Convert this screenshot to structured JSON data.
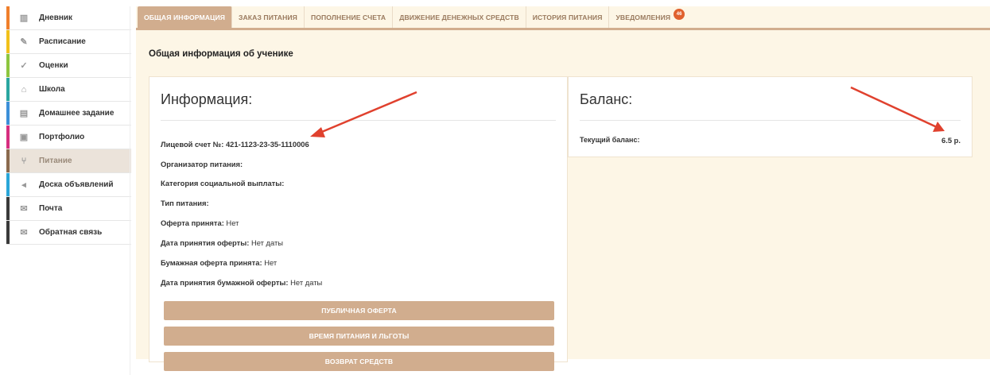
{
  "sidebar": {
    "items": [
      {
        "label": "Дневник",
        "icon": "book-icon",
        "color": "#f07f2b",
        "glyph": "▥"
      },
      {
        "label": "Расписание",
        "icon": "pin-icon",
        "color": "#f2c11b",
        "glyph": "✎"
      },
      {
        "label": "Оценки",
        "icon": "check-icon",
        "color": "#8dc63f",
        "glyph": "✓"
      },
      {
        "label": "Школа",
        "icon": "school-icon",
        "color": "#2aa6a0",
        "glyph": "⌂"
      },
      {
        "label": "Домашнее задание",
        "icon": "homework-icon",
        "color": "#3c8fd8",
        "glyph": "▤"
      },
      {
        "label": "Портфолио",
        "icon": "portfolio-icon",
        "color": "#d62e7f",
        "glyph": "▣"
      },
      {
        "label": "Питание",
        "icon": "food-icon",
        "color": "#8a6a4e",
        "glyph": "⑂"
      },
      {
        "label": "Доска объявлений",
        "icon": "megaphone-icon",
        "color": "#2aa6d8",
        "glyph": "◂"
      },
      {
        "label": "Почта",
        "icon": "mail-icon",
        "color": "#3a3a3a",
        "glyph": "✉"
      },
      {
        "label": "Обратная связь",
        "icon": "feedback-icon",
        "color": "#3a3a3a",
        "glyph": "✉"
      }
    ],
    "active_index": 6
  },
  "tabs": [
    {
      "label": "ОБЩАЯ ИНФОРМАЦИЯ",
      "active": true
    },
    {
      "label": "ЗАКАЗ ПИТАНИЯ",
      "active": false
    },
    {
      "label": "ПОПОЛНЕНИЕ СЧЕТА",
      "active": false
    },
    {
      "label": "ДВИЖЕНИЕ ДЕНЕЖНЫХ СРЕДСТВ",
      "active": false
    },
    {
      "label": "ИСТОРИЯ ПИТАНИЯ",
      "active": false
    },
    {
      "label": "УВЕДОМЛЕНИЯ",
      "active": false,
      "badge": "46"
    }
  ],
  "page_title": "Общая информация об ученике",
  "info": {
    "title": "Информация:",
    "rows": [
      {
        "label": "Лицевой счет №:",
        "value": "421-1123-23-35-1110006",
        "value_bold": true
      },
      {
        "label": "Организатор питания:",
        "value": ""
      },
      {
        "label": "Категория социальной выплаты:",
        "value": ""
      },
      {
        "label": "Тип питания:",
        "value": ""
      },
      {
        "label": "Оферта принята:",
        "value": "Нет"
      },
      {
        "label": "Дата принятия оферты:",
        "value": "Нет даты"
      },
      {
        "label": "Бумажная оферта принята:",
        "value": "Нет"
      },
      {
        "label": "Дата принятия бумажной оферты:",
        "value": "Нет даты"
      }
    ],
    "buttons": [
      "ПУБЛИЧНАЯ ОФЕРТА",
      "ВРЕМЯ ПИТАНИЯ И ЛЬГОТЫ",
      "ВОЗВРАТ СРЕДСТВ"
    ]
  },
  "balance": {
    "title": "Баланс:",
    "label": "Текущий баланс:",
    "value": "6.5 р."
  },
  "colors": {
    "accent": "#d1ad8e",
    "panel_bg": "#fdf6e6",
    "annotation_arrow": "#e0412e",
    "badge": "#e0612e"
  }
}
